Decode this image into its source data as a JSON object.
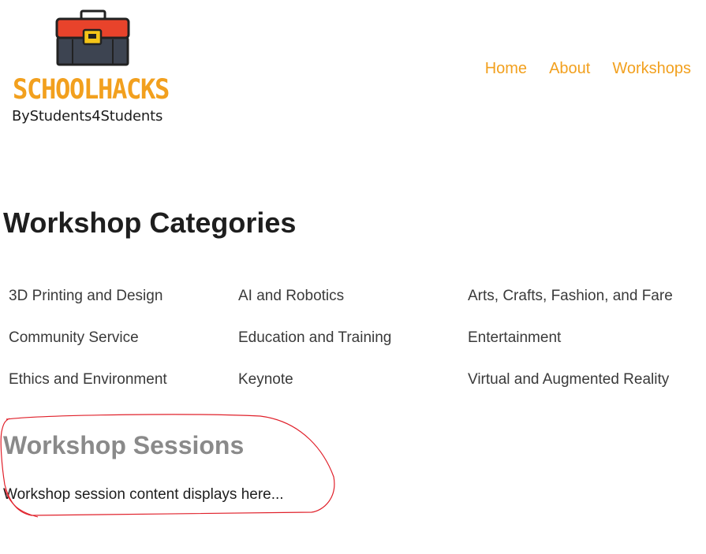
{
  "logo": {
    "wordmark": "SCHOOLHACKS",
    "tagline": "ByStudents4Students",
    "icon": "toolbox-icon",
    "colors": {
      "wordmark": "#f2a01e",
      "toolbox_lid": "#e8432b",
      "toolbox_body": "#3d4451",
      "latch": "#f5c518"
    }
  },
  "nav": {
    "items": [
      {
        "label": "Home"
      },
      {
        "label": "About"
      },
      {
        "label": "Workshops"
      }
    ],
    "color": "#f2a01e"
  },
  "categories": {
    "heading": "Workshop Categories",
    "items": [
      {
        "label": "3D Printing and Design"
      },
      {
        "label": "AI and Robotics"
      },
      {
        "label": "Arts, Crafts, Fashion, and Fare"
      },
      {
        "label": "Community Service"
      },
      {
        "label": "Education and Training"
      },
      {
        "label": "Entertainment"
      },
      {
        "label": "Ethics and Environment"
      },
      {
        "label": "Keynote"
      },
      {
        "label": "Virtual and Augmented Reality"
      }
    ]
  },
  "sessions": {
    "heading": "Workshop Sessions",
    "text": "Workshop session content displays here..."
  },
  "annotation": {
    "shape": "hand-drawn-ellipse",
    "color": "#e0202a"
  }
}
